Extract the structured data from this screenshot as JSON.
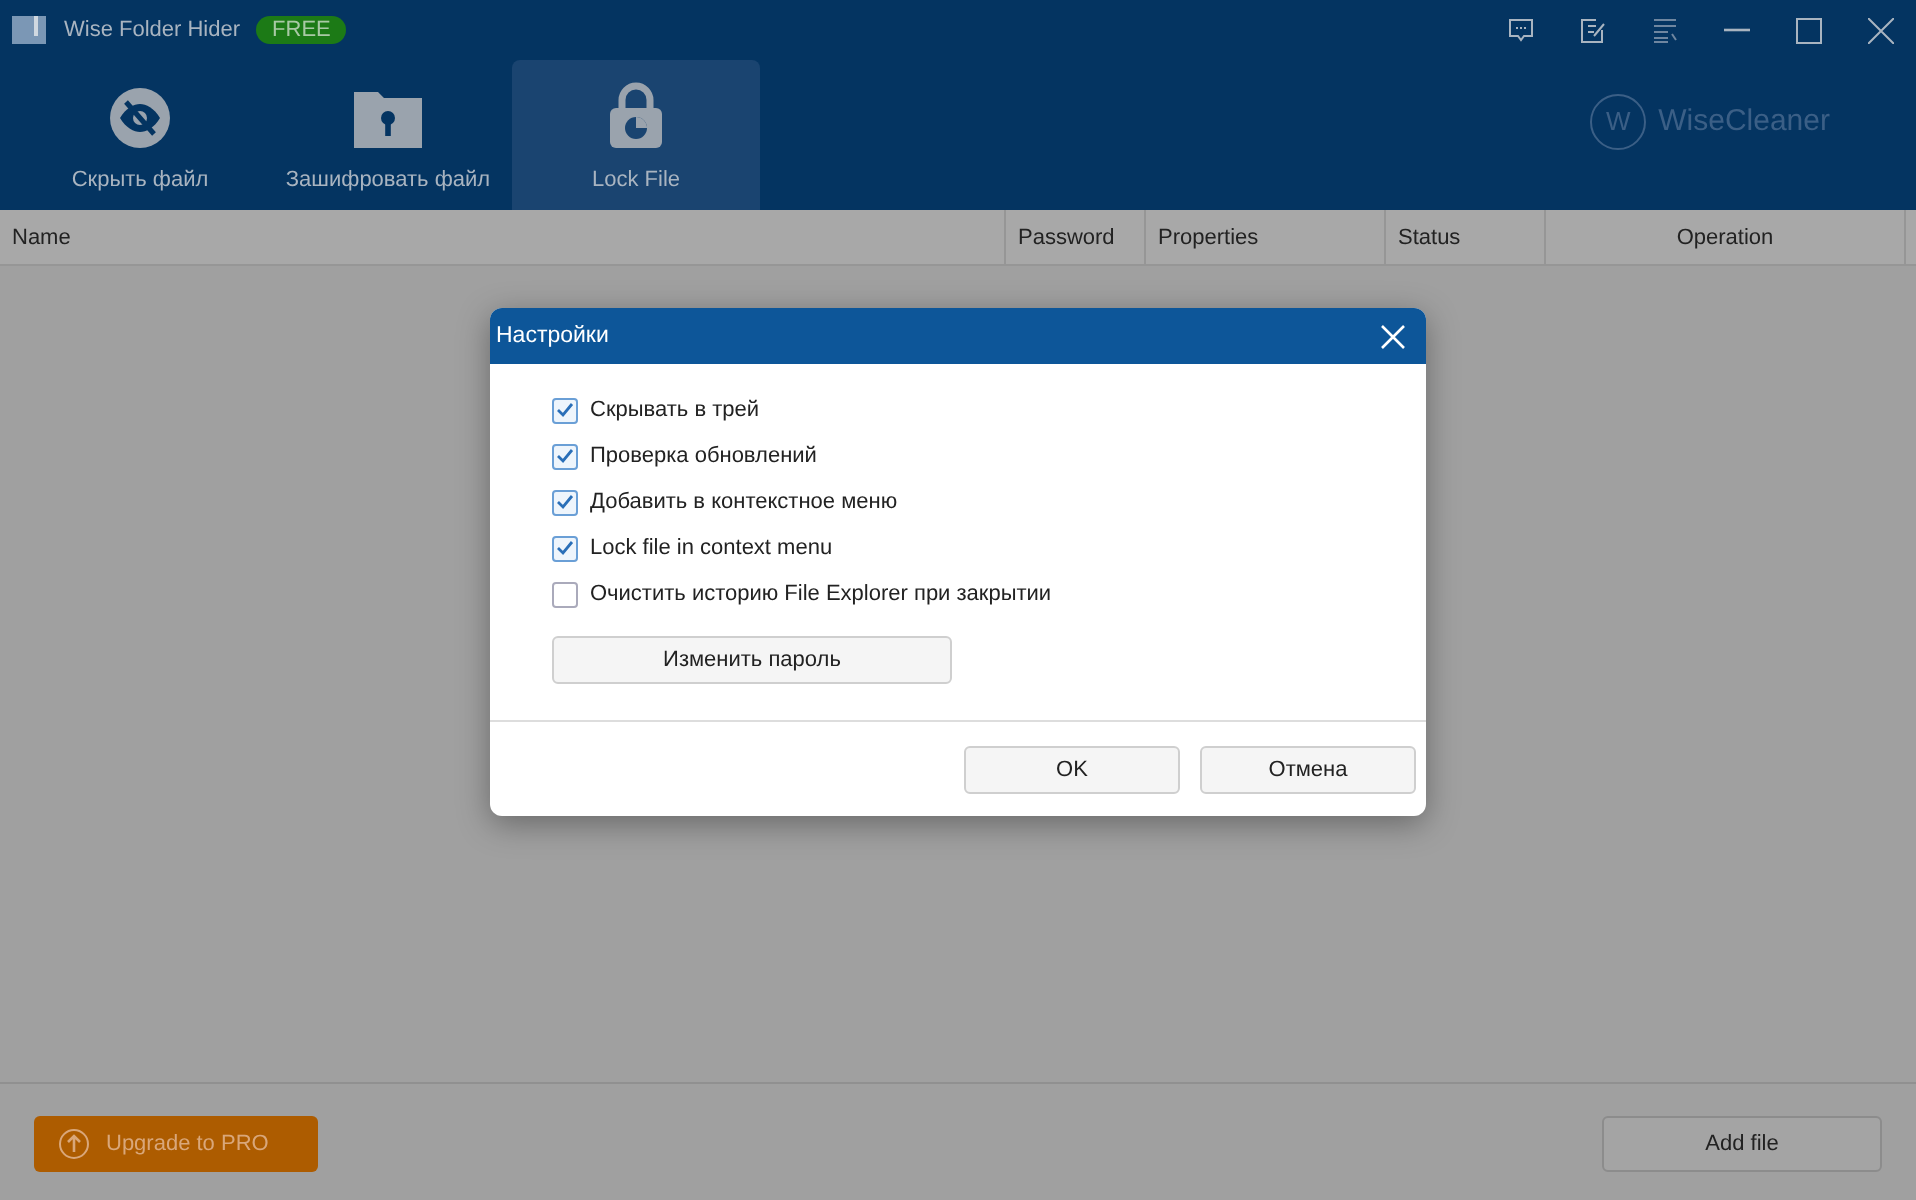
{
  "window": {
    "title": "Wise Folder Hider",
    "badge": "FREE"
  },
  "toolbar": {
    "tabs": [
      {
        "kind": "hide",
        "label": "Скрыть файл",
        "selected": false
      },
      {
        "kind": "encrypt",
        "label": "Зашифровать файл",
        "selected": false
      },
      {
        "kind": "lock",
        "label": "Lock File",
        "selected": true
      }
    ],
    "logo": {
      "mark": "W",
      "text": "WiseCleaner"
    }
  },
  "table": {
    "columns": [
      "Name",
      "Password",
      "Properties",
      "Status",
      "Operation"
    ]
  },
  "footer": {
    "upgrade_button": "Upgrade to PRO",
    "add_button": "Add file"
  },
  "dialog": {
    "title": "Настройки",
    "options": [
      {
        "label": "Скрывать в трей",
        "checked": true
      },
      {
        "label": "Проверка обновлений",
        "checked": true
      },
      {
        "label": "Добавить в контекстное меню",
        "checked": true
      },
      {
        "label": "Lock file in context menu",
        "checked": true
      },
      {
        "label": "Очистить историю File Explorer при закрытии",
        "checked": false
      }
    ],
    "change_password_button": "Изменить пароль",
    "buttons": [
      "OK",
      "Отмена"
    ]
  }
}
